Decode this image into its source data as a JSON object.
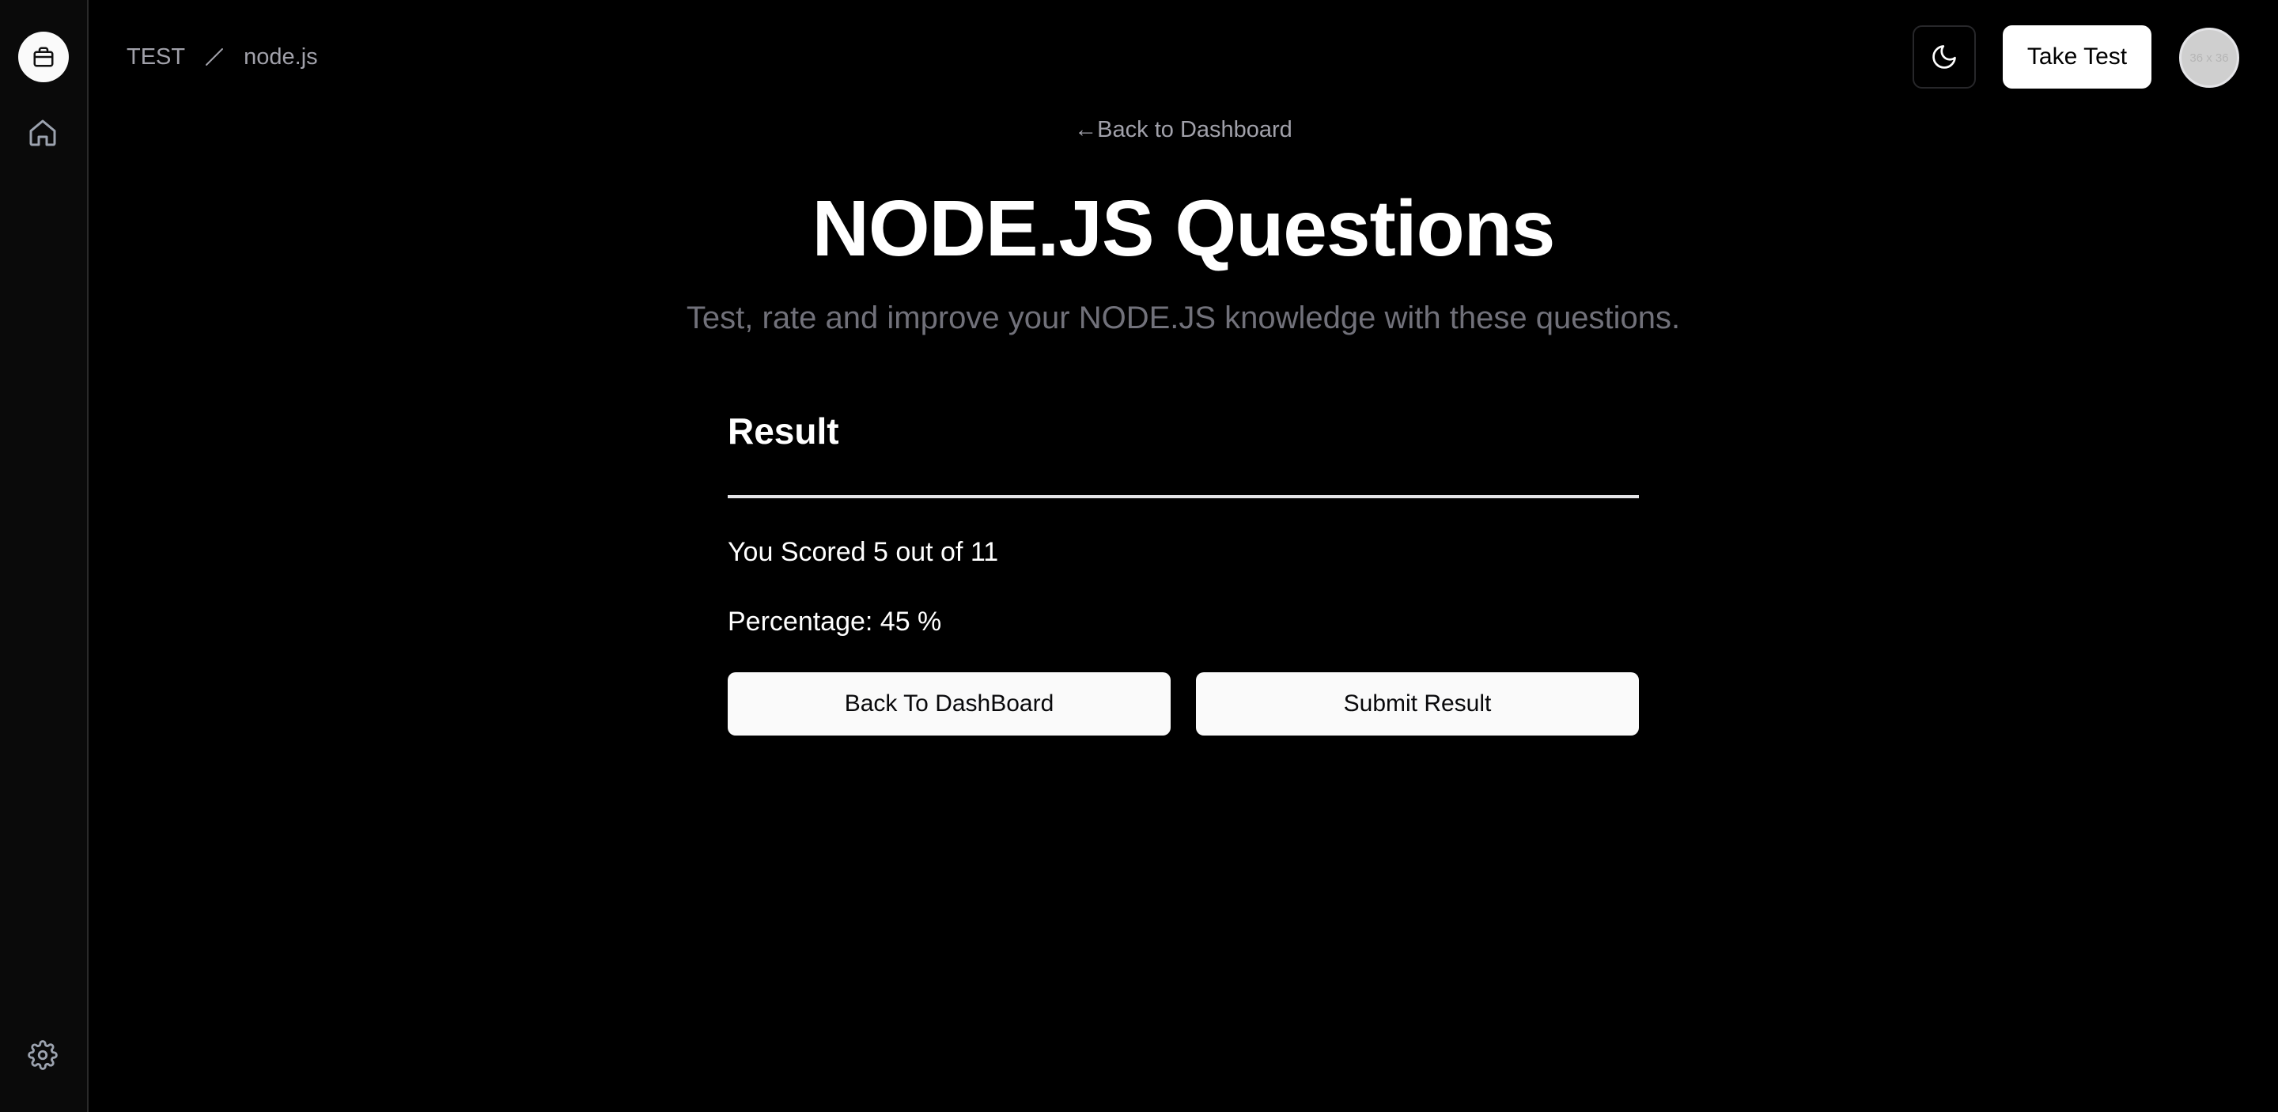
{
  "sidebar": {
    "items": [
      {
        "icon": "home-icon",
        "label": "Home"
      },
      {
        "icon": "gear-icon",
        "label": "Settings"
      }
    ]
  },
  "header": {
    "breadcrumb": [
      "TEST",
      "node.js"
    ],
    "take_test_label": "Take Test",
    "avatar_text": "36 x 36"
  },
  "main": {
    "back_link": "←Back to Dashboard",
    "title": "NODE.JS Questions",
    "subtitle": "Test, rate and improve your NODE.JS knowledge with these questions."
  },
  "result": {
    "title": "Result",
    "score_text": "You Scored 5 out of 11",
    "percentage_text": "Percentage: 45 %",
    "back_button": "Back To DashBoard",
    "submit_button": "Submit Result"
  },
  "colors": {
    "background": "#000000",
    "button_bg": "#fafafa",
    "muted_text": "#71717a"
  }
}
